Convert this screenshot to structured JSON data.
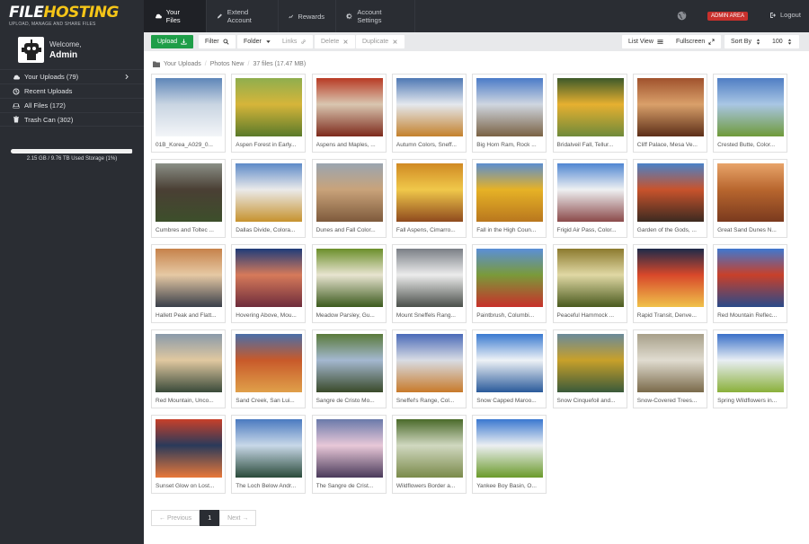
{
  "brand": {
    "name_white": "FILE",
    "name_yellow": "HOSTING",
    "tagline": "UPLOAD, MANAGE AND SHARE FILES"
  },
  "topnav": {
    "your_files": "Your Files",
    "extend": "Extend Account",
    "rewards": "Rewards",
    "settings": "Account Settings",
    "admin_area": "ADMIN AREA",
    "logout": "Logout"
  },
  "sidebar": {
    "welcome": "Welcome,",
    "username": "Admin",
    "items": [
      {
        "label": "Your Uploads (79)"
      },
      {
        "label": "Recent Uploads"
      },
      {
        "label": "All Files (172)"
      },
      {
        "label": "Trash Can (302)"
      }
    ],
    "storage_text": "2.15 GB / 9.76 TB Used Storage (1%)",
    "storage_fraction": 0.99
  },
  "toolbar": {
    "upload": "Upload",
    "filter": "Filter",
    "folder": "Folder",
    "links": "Links",
    "delete": "Delete",
    "duplicate": "Duplicate",
    "list_view": "List View",
    "fullscreen": "Fullscreen",
    "sort_by": "Sort By",
    "per_page": "100"
  },
  "breadcrumb": {
    "root": "Your Uploads",
    "folder": "Photos New",
    "info": "37 files (17.47 MB)"
  },
  "files": [
    {
      "caption": "01B_Korea_A029_0...",
      "colors": [
        "#5e86b8",
        "#c9d5e2",
        "#f3f5f8"
      ]
    },
    {
      "caption": "Aspen Forest in Early...",
      "colors": [
        "#8fae4e",
        "#d6b53a",
        "#5a7a2a"
      ]
    },
    {
      "caption": "Aspens and Maples, ...",
      "colors": [
        "#b83a24",
        "#d9c6b0",
        "#7d2a1c"
      ]
    },
    {
      "caption": "Autumn Colors, Sneff...",
      "colors": [
        "#4e78b4",
        "#e4e8ee",
        "#c4812c"
      ]
    },
    {
      "caption": "Big Horn Ram, Rock ...",
      "colors": [
        "#4a7bc8",
        "#cfd6e0",
        "#7a6244"
      ]
    },
    {
      "caption": "Bridalveil Fall, Tellur...",
      "colors": [
        "#3d5a2a",
        "#e6b030",
        "#6f8a3a"
      ]
    },
    {
      "caption": "Cliff Palace, Mesa Ve...",
      "colors": [
        "#a0522d",
        "#d9a06a",
        "#5c2e18"
      ]
    },
    {
      "caption": "Crested Butte, Color...",
      "colors": [
        "#4f7ec4",
        "#a9c6e4",
        "#6f9a3a"
      ]
    },
    {
      "caption": "Cumbres and Toltec ...",
      "colors": [
        "#8a8f86",
        "#4a3f34",
        "#3d4f2b"
      ]
    },
    {
      "caption": "Dallas Divide, Colora...",
      "colors": [
        "#5d8ac8",
        "#eaeaea",
        "#c7922e"
      ]
    },
    {
      "caption": "Dunes and Fall Color...",
      "colors": [
        "#9aa5b0",
        "#c9a37a",
        "#7e5a3c"
      ]
    },
    {
      "caption": "Fall Aspens, Cimarro...",
      "colors": [
        "#d08a24",
        "#f0c84a",
        "#8f4a1e"
      ]
    },
    {
      "caption": "Fall in the High Coun...",
      "colors": [
        "#5b8ed0",
        "#e6b226",
        "#b9771e"
      ]
    },
    {
      "caption": "Frigid Air Pass, Color...",
      "colors": [
        "#4f86d2",
        "#eef0f2",
        "#8b4a4a"
      ]
    },
    {
      "caption": "Garden of the Gods, ...",
      "colors": [
        "#4a82c8",
        "#c8532c",
        "#3c2a20"
      ]
    },
    {
      "caption": "Great Sand Dunes N...",
      "colors": [
        "#e8a46a",
        "#b8662e",
        "#7a3a1e"
      ]
    },
    {
      "caption": "Hallett Peak and Flatt...",
      "colors": [
        "#c6824a",
        "#e6c9a4",
        "#3a3f4a"
      ]
    },
    {
      "caption": "Hovering Above, Mou...",
      "colors": [
        "#1f3c7a",
        "#d67a5a",
        "#6e2c3c"
      ]
    },
    {
      "caption": "Meadow Parsley, Gu...",
      "colors": [
        "#6b8f2a",
        "#e8e4d0",
        "#3c5a1e"
      ]
    },
    {
      "caption": "Mount Sneffels Rang...",
      "colors": [
        "#7a7f86",
        "#ececec",
        "#4a4f4a"
      ]
    },
    {
      "caption": "Paintbrush, Columbi...",
      "colors": [
        "#5a8fd8",
        "#7a9a3a",
        "#c8302a"
      ]
    },
    {
      "caption": "Peaceful Hammock ...",
      "colors": [
        "#8c7a2e",
        "#e0d8a4",
        "#4a5a1e"
      ]
    },
    {
      "caption": "Rapid Transit, Denve...",
      "colors": [
        "#1e2a4a",
        "#d8482a",
        "#f0c24a"
      ]
    },
    {
      "caption": "Red Mountain Reflec...",
      "colors": [
        "#3f78d0",
        "#c8402a",
        "#2a4a8a"
      ]
    },
    {
      "caption": "Red Mountain, Unco...",
      "colors": [
        "#8a9aaa",
        "#e0c8a0",
        "#3a4a3a"
      ]
    },
    {
      "caption": "Sand Creek, San Lui...",
      "colors": [
        "#4a6ea8",
        "#c85a2a",
        "#e0a04a"
      ]
    },
    {
      "caption": "Sangre de Cristo Mo...",
      "colors": [
        "#5a7a3a",
        "#a4b8d0",
        "#3a4a2a"
      ]
    },
    {
      "caption": "Sneffel's Range, Col...",
      "colors": [
        "#4a6ab8",
        "#d8dce4",
        "#c87a2a"
      ]
    },
    {
      "caption": "Snow Capped Maroo...",
      "colors": [
        "#3a7ad0",
        "#eef2f6",
        "#2a5a9a"
      ]
    },
    {
      "caption": "Snow Cinquefoil and...",
      "colors": [
        "#6a8a9a",
        "#c8a02a",
        "#3a5a3a"
      ]
    },
    {
      "caption": "Snow-Covered Trees...",
      "colors": [
        "#a8a08a",
        "#e0dcd0",
        "#7a6a4a"
      ]
    },
    {
      "caption": "Spring Wildflowers in...",
      "colors": [
        "#3a70c8",
        "#e8eef4",
        "#8ab03a"
      ]
    },
    {
      "caption": "Sunset Glow on Lost...",
      "colors": [
        "#c8402a",
        "#2a3a5a",
        "#e8783a"
      ]
    },
    {
      "caption": "The Loch Below Andr...",
      "colors": [
        "#4a7ac0",
        "#c8d8e8",
        "#2a4a3a"
      ]
    },
    {
      "caption": "The Sangre de Crist...",
      "colors": [
        "#6a7aaa",
        "#e8c8d8",
        "#4a3a5a"
      ]
    },
    {
      "caption": "Wildflowers Border a...",
      "colors": [
        "#4a6a2a",
        "#d0d8c0",
        "#7a8a4a"
      ]
    },
    {
      "caption": "Yankee Boy Basin, O...",
      "colors": [
        "#3a78d0",
        "#eceff2",
        "#6a9a2a"
      ]
    }
  ],
  "pager": {
    "previous": "← Previous",
    "current": "1",
    "next": "Next →"
  }
}
